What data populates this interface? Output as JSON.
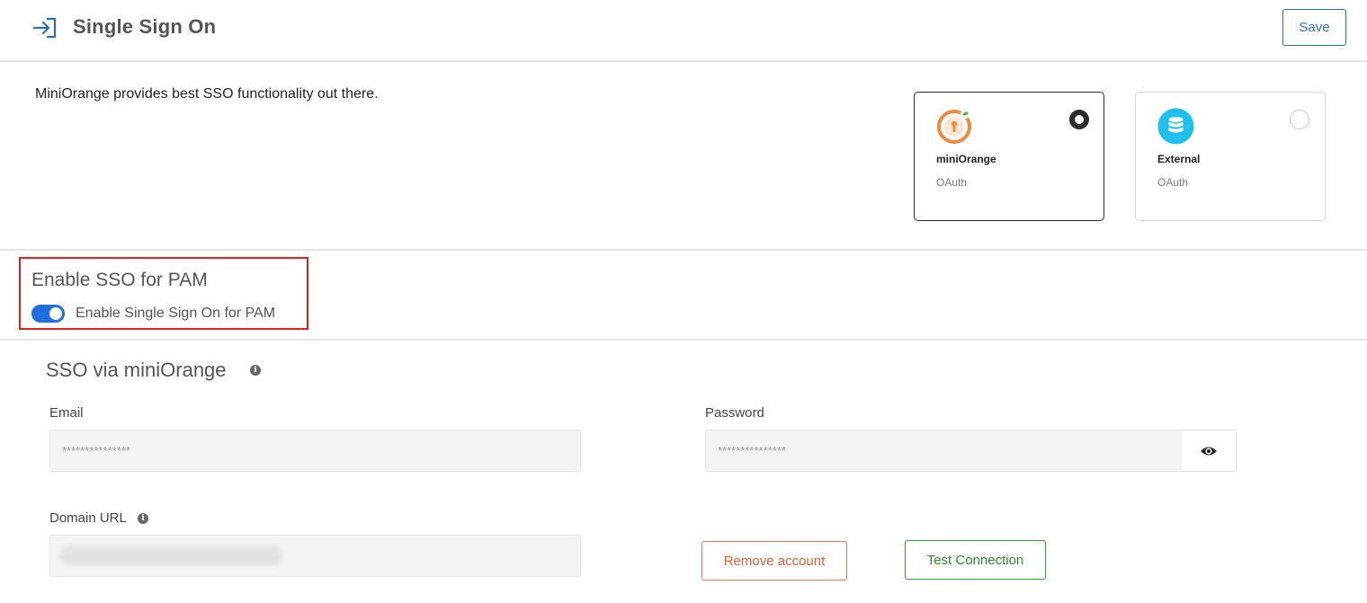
{
  "header": {
    "title": "Single Sign On",
    "save_label": "Save"
  },
  "intro": {
    "description": "MiniOrange provides best SSO functionality out there."
  },
  "providers": [
    {
      "name": "miniOrange",
      "type": "OAuth",
      "selected": true,
      "icon": "miniorange-logo"
    },
    {
      "name": "External",
      "type": "OAuth",
      "selected": false,
      "icon": "database-icon"
    }
  ],
  "enable_sso": {
    "title": "Enable SSO for PAM",
    "toggle_label": "Enable Single Sign On for PAM",
    "enabled": true
  },
  "sso_section": {
    "title": "SSO via miniOrange",
    "email_label": "Email",
    "email_value": "***************",
    "password_label": "Password",
    "password_value": "***************",
    "domain_label": "Domain URL",
    "remove_label": "Remove account",
    "test_label": "Test Connection"
  },
  "colors": {
    "accent": "#2f6fb0",
    "toggle_on": "#1f6fe0",
    "highlight": "#e01f1f",
    "remove": "#e0603a",
    "test": "#2f8a2f",
    "miniorange_orange": "#f08a3c",
    "external_cyan": "#1ec0f0"
  }
}
